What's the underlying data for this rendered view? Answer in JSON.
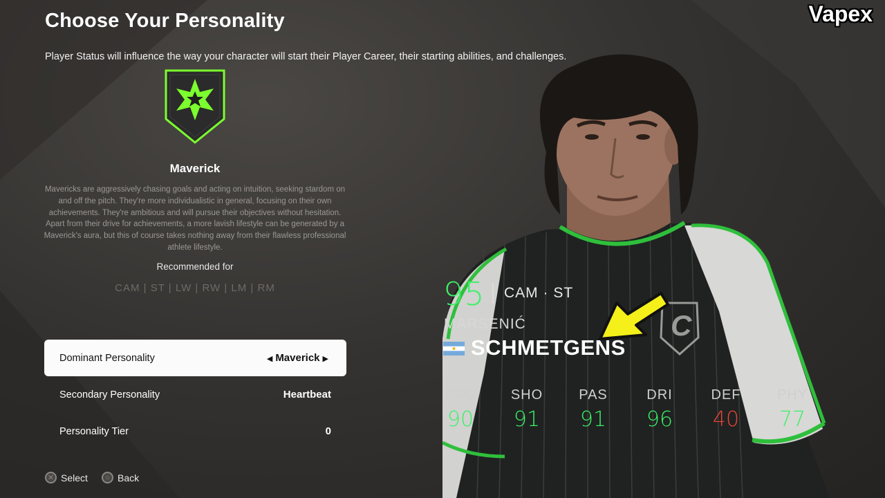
{
  "header": {
    "title": "Choose Your Personality",
    "subtitle": "Player Status will influence the way your character will start their Player Career, their starting abilities, and challenges."
  },
  "watermark": "Vapex",
  "personality": {
    "name": "Maverick",
    "badge_icon": "star-shield-icon",
    "description": "Mavericks are aggressively chasing goals and acting on intuition, seeking stardom on and off the pitch. They're more individualistic in general, focusing on their own achievements. They're ambitious and will pursue their objectives without hesitation. Apart from their drive for achievements, a more lavish lifestyle can be generated by a Maverick's aura, but this of course takes nothing away from their flawless professional athlete lifestyle.",
    "recommended_label": "Recommended for",
    "recommended_positions": "CAM | ST | LW | RW | LM | RM"
  },
  "options": {
    "dominant": {
      "label": "Dominant Personality",
      "value": "Maverick"
    },
    "secondary": {
      "label": "Secondary Personality",
      "value": "Heartbeat"
    },
    "tier": {
      "label": "Personality Tier",
      "value": "0"
    }
  },
  "hints": {
    "select": "Select",
    "back": "Back"
  },
  "player": {
    "overall": "95",
    "positions": "CAM · ST",
    "first_name": "MARSENIĆ",
    "last_name": "SCHMETGENS",
    "nationality_icon": "argentina-flag-icon",
    "stats": [
      {
        "label": "PAC",
        "value": "90",
        "color": "#3cf067"
      },
      {
        "label": "SHO",
        "value": "91",
        "color": "#3cf067"
      },
      {
        "label": "PAS",
        "value": "91",
        "color": "#3cf067"
      },
      {
        "label": "DRI",
        "value": "96",
        "color": "#3cf067"
      },
      {
        "label": "DEF",
        "value": "40",
        "color": "#e8443a"
      },
      {
        "label": "PHY",
        "value": "77",
        "color": "#3cf067"
      }
    ]
  },
  "colors": {
    "accent": "#3cf067",
    "badge_green": "#7cff2e",
    "arrow_yellow": "#f5f01a"
  }
}
